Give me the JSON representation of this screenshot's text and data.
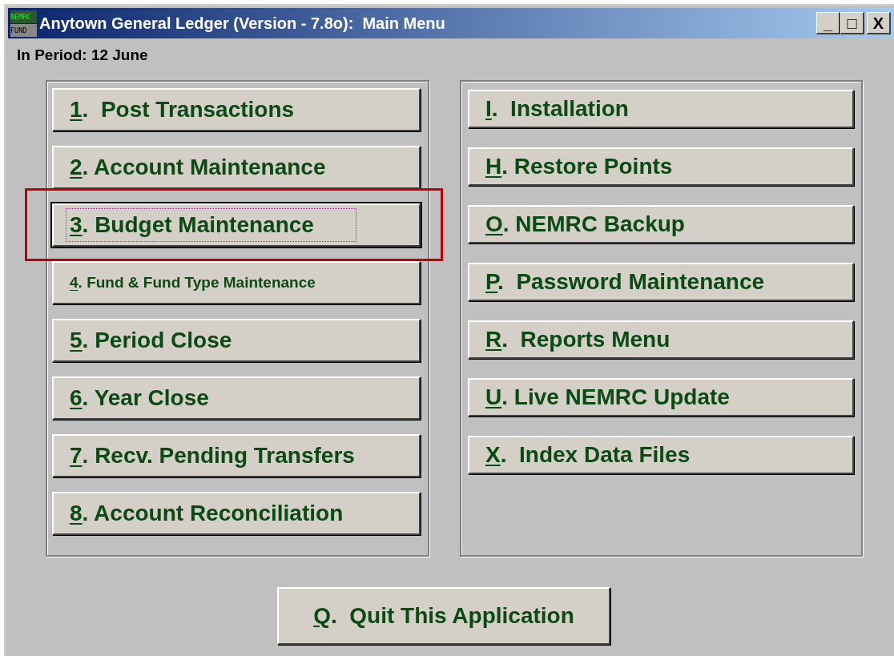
{
  "window": {
    "title": "Anytown General Ledger (Version - 7.8o):  Main Menu",
    "icon_text": [
      "NEMRC",
      "FUND"
    ],
    "controls": [
      "_",
      "□",
      "X"
    ]
  },
  "period": "In Period: 12 June",
  "left_buttons": [
    {
      "key": "1",
      "label": ".  Post Transactions",
      "kind": "standard",
      "focused": false,
      "highlighted": false
    },
    {
      "key": "2",
      "label": ". Account Maintenance",
      "kind": "standard",
      "focused": false,
      "highlighted": false
    },
    {
      "key": "3",
      "label": ". Budget Maintenance",
      "kind": "standard",
      "focused": true,
      "highlighted": true
    },
    {
      "key": "4",
      "label": ". Fund & Fund Type Maintenance",
      "kind": "compact",
      "focused": false,
      "highlighted": false
    },
    {
      "key": "5",
      "label": ". Period Close",
      "kind": "standard",
      "focused": false,
      "highlighted": false
    },
    {
      "key": "6",
      "label": ". Year Close",
      "kind": "standard",
      "focused": false,
      "highlighted": false
    },
    {
      "key": "7",
      "label": ". Recv. Pending Transfers",
      "kind": "standard",
      "focused": false,
      "highlighted": false
    },
    {
      "key": "8",
      "label": ". Account Reconciliation",
      "kind": "standard",
      "focused": false,
      "highlighted": false
    }
  ],
  "right_buttons": [
    {
      "key": "I",
      "label": ".  Installation",
      "kind": "standard",
      "focused": false,
      "highlighted": false
    },
    {
      "key": "H",
      "label": ". Restore Points",
      "kind": "standard",
      "focused": false,
      "highlighted": false
    },
    {
      "key": "O",
      "label": ". NEMRC Backup",
      "kind": "standard",
      "focused": false,
      "highlighted": false
    },
    {
      "key": "P",
      "label": ".  Password Maintenance",
      "kind": "standard",
      "focused": false,
      "highlighted": false
    },
    {
      "key": "R",
      "label": ".  Reports Menu",
      "kind": "standard",
      "focused": false,
      "highlighted": false
    },
    {
      "key": "U",
      "label": ". Live NEMRC Update",
      "kind": "standard",
      "focused": false,
      "highlighted": false
    },
    {
      "key": "X",
      "label": ".  Index Data Files",
      "kind": "standard",
      "focused": false,
      "highlighted": false
    }
  ],
  "quit_button": {
    "key": "Q",
    "label": ".  Quit This Application"
  }
}
